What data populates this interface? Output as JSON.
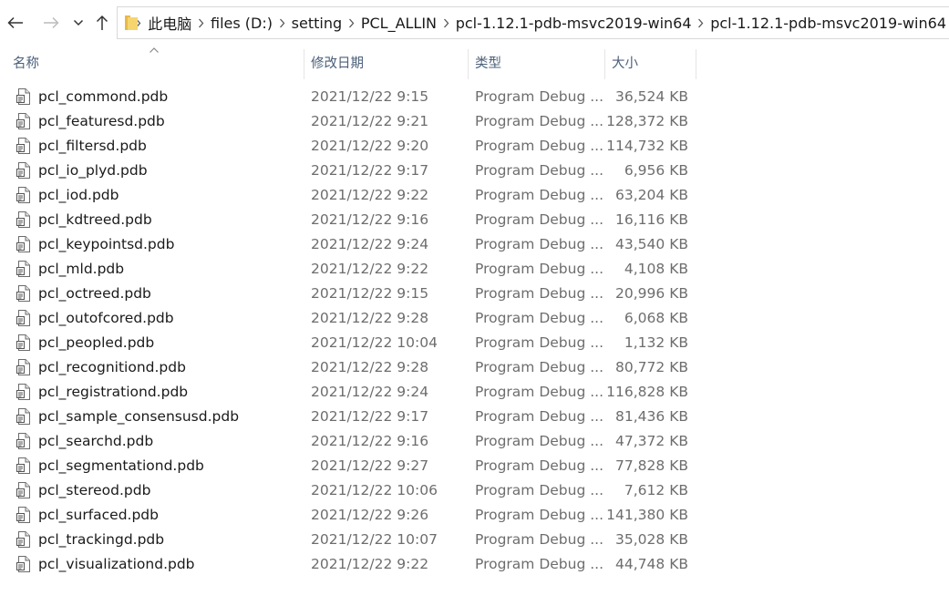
{
  "nav": {
    "back_icon": "arrow-left-icon",
    "forward_icon": "arrow-right-icon",
    "recent_icon": "chevron-down-icon",
    "up_icon": "arrow-up-icon"
  },
  "breadcrumb": [
    "此电脑",
    "files (D:)",
    "setting",
    "PCL_ALLIN",
    "pcl-1.12.1-pdb-msvc2019-win64",
    "pcl-1.12.1-pdb-msvc2019-win64"
  ],
  "columns": {
    "name": "名称",
    "date": "修改日期",
    "type": "类型",
    "size": "大小"
  },
  "colors": {
    "header_text": "#4c607a",
    "folder": "#f6d56e",
    "meta_text": "#6d6d6d"
  },
  "files": [
    {
      "name": "pcl_commond.pdb",
      "date": "2021/12/22 9:15",
      "type": "Program Debug ...",
      "size": "36,524 KB"
    },
    {
      "name": "pcl_featuresd.pdb",
      "date": "2021/12/22 9:21",
      "type": "Program Debug ...",
      "size": "128,372 KB"
    },
    {
      "name": "pcl_filtersd.pdb",
      "date": "2021/12/22 9:20",
      "type": "Program Debug ...",
      "size": "114,732 KB"
    },
    {
      "name": "pcl_io_plyd.pdb",
      "date": "2021/12/22 9:17",
      "type": "Program Debug ...",
      "size": "6,956 KB"
    },
    {
      "name": "pcl_iod.pdb",
      "date": "2021/12/22 9:22",
      "type": "Program Debug ...",
      "size": "63,204 KB"
    },
    {
      "name": "pcl_kdtreed.pdb",
      "date": "2021/12/22 9:16",
      "type": "Program Debug ...",
      "size": "16,116 KB"
    },
    {
      "name": "pcl_keypointsd.pdb",
      "date": "2021/12/22 9:24",
      "type": "Program Debug ...",
      "size": "43,540 KB"
    },
    {
      "name": "pcl_mld.pdb",
      "date": "2021/12/22 9:22",
      "type": "Program Debug ...",
      "size": "4,108 KB"
    },
    {
      "name": "pcl_octreed.pdb",
      "date": "2021/12/22 9:15",
      "type": "Program Debug ...",
      "size": "20,996 KB"
    },
    {
      "name": "pcl_outofcored.pdb",
      "date": "2021/12/22 9:28",
      "type": "Program Debug ...",
      "size": "6,068 KB"
    },
    {
      "name": "pcl_peopled.pdb",
      "date": "2021/12/22 10:04",
      "type": "Program Debug ...",
      "size": "1,132 KB"
    },
    {
      "name": "pcl_recognitiond.pdb",
      "date": "2021/12/22 9:28",
      "type": "Program Debug ...",
      "size": "80,772 KB"
    },
    {
      "name": "pcl_registrationd.pdb",
      "date": "2021/12/22 9:24",
      "type": "Program Debug ...",
      "size": "116,828 KB"
    },
    {
      "name": "pcl_sample_consensusd.pdb",
      "date": "2021/12/22 9:17",
      "type": "Program Debug ...",
      "size": "81,436 KB"
    },
    {
      "name": "pcl_searchd.pdb",
      "date": "2021/12/22 9:16",
      "type": "Program Debug ...",
      "size": "47,372 KB"
    },
    {
      "name": "pcl_segmentationd.pdb",
      "date": "2021/12/22 9:27",
      "type": "Program Debug ...",
      "size": "77,828 KB"
    },
    {
      "name": "pcl_stereod.pdb",
      "date": "2021/12/22 10:06",
      "type": "Program Debug ...",
      "size": "7,612 KB"
    },
    {
      "name": "pcl_surfaced.pdb",
      "date": "2021/12/22 9:26",
      "type": "Program Debug ...",
      "size": "141,380 KB"
    },
    {
      "name": "pcl_trackingd.pdb",
      "date": "2021/12/22 10:07",
      "type": "Program Debug ...",
      "size": "35,028 KB"
    },
    {
      "name": "pcl_visualizationd.pdb",
      "date": "2021/12/22 9:22",
      "type": "Program Debug ...",
      "size": "44,748 KB"
    }
  ]
}
